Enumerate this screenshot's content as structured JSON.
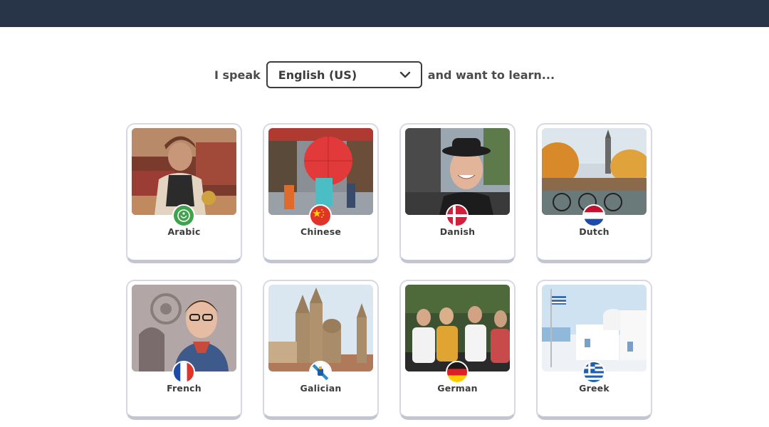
{
  "header": {
    "bar_color": "#283548"
  },
  "selector": {
    "prefix": "I speak",
    "selected_language": "English (US)",
    "suffix": "and want to learn..."
  },
  "languages": [
    {
      "name": "Arabic",
      "flag_icon": "arabic-flag-icon"
    },
    {
      "name": "Chinese",
      "flag_icon": "china-flag-icon"
    },
    {
      "name": "Danish",
      "flag_icon": "denmark-flag-icon"
    },
    {
      "name": "Dutch",
      "flag_icon": "netherlands-flag-icon"
    },
    {
      "name": "French",
      "flag_icon": "france-flag-icon"
    },
    {
      "name": "Galician",
      "flag_icon": "galicia-flag-icon"
    },
    {
      "name": "German",
      "flag_icon": "germany-flag-icon"
    },
    {
      "name": "Greek",
      "flag_icon": "greece-flag-icon"
    }
  ]
}
